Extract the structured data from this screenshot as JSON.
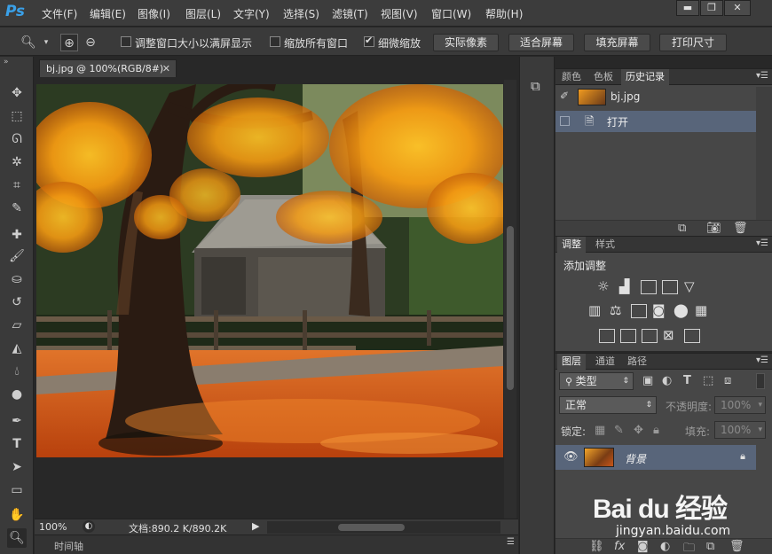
{
  "app": {
    "logo": "Ps"
  },
  "menu": [
    "文件(F)",
    "编辑(E)",
    "图像(I)",
    "图层(L)",
    "文字(Y)",
    "选择(S)",
    "滤镜(T)",
    "视图(V)",
    "窗口(W)",
    "帮助(H)"
  ],
  "window_controls": {
    "minimize": "▬",
    "maximize": "❐",
    "close": "✕"
  },
  "options": {
    "resize_windows_label": "调整窗口大小以满屏显示",
    "zoom_all_label": "缩放所有窗口",
    "scrubby_zoom_label": "细微缩放",
    "scrubby_zoom_checked": true,
    "actual_pixels": "实际像素",
    "fit_screen": "适合屏幕",
    "fill_screen": "填充屏幕",
    "print_size": "打印尺寸"
  },
  "document": {
    "tab_title": "bj.jpg @ 100%(RGB/8#)",
    "zoom": "100%",
    "doc_size": "文档:890.2 K/890.2K",
    "timeline_label": "时间轴"
  },
  "panels": {
    "top_tabs": [
      "颜色",
      "色板",
      "历史记录"
    ],
    "history_snapshot": "bj.jpg",
    "history_items": [
      "打开"
    ],
    "adjust_tabs": [
      "调整",
      "样式"
    ],
    "adjust_title": "添加调整",
    "layers_tabs": [
      "图层",
      "通道",
      "路径"
    ],
    "filter_type": "类型",
    "blend_mode": "正常",
    "opacity_label": "不透明度:",
    "opacity_value": "100%",
    "lock_label": "锁定:",
    "fill_label": "填充:",
    "fill_value": "100%",
    "layer_name": "背景"
  },
  "watermark": {
    "brand": "Bai du 经验",
    "url": "jingyan.baidu.com"
  },
  "colors": {
    "accent": "#3aa0e8",
    "selected_row": "#58657a",
    "panel_bg": "#474747"
  }
}
